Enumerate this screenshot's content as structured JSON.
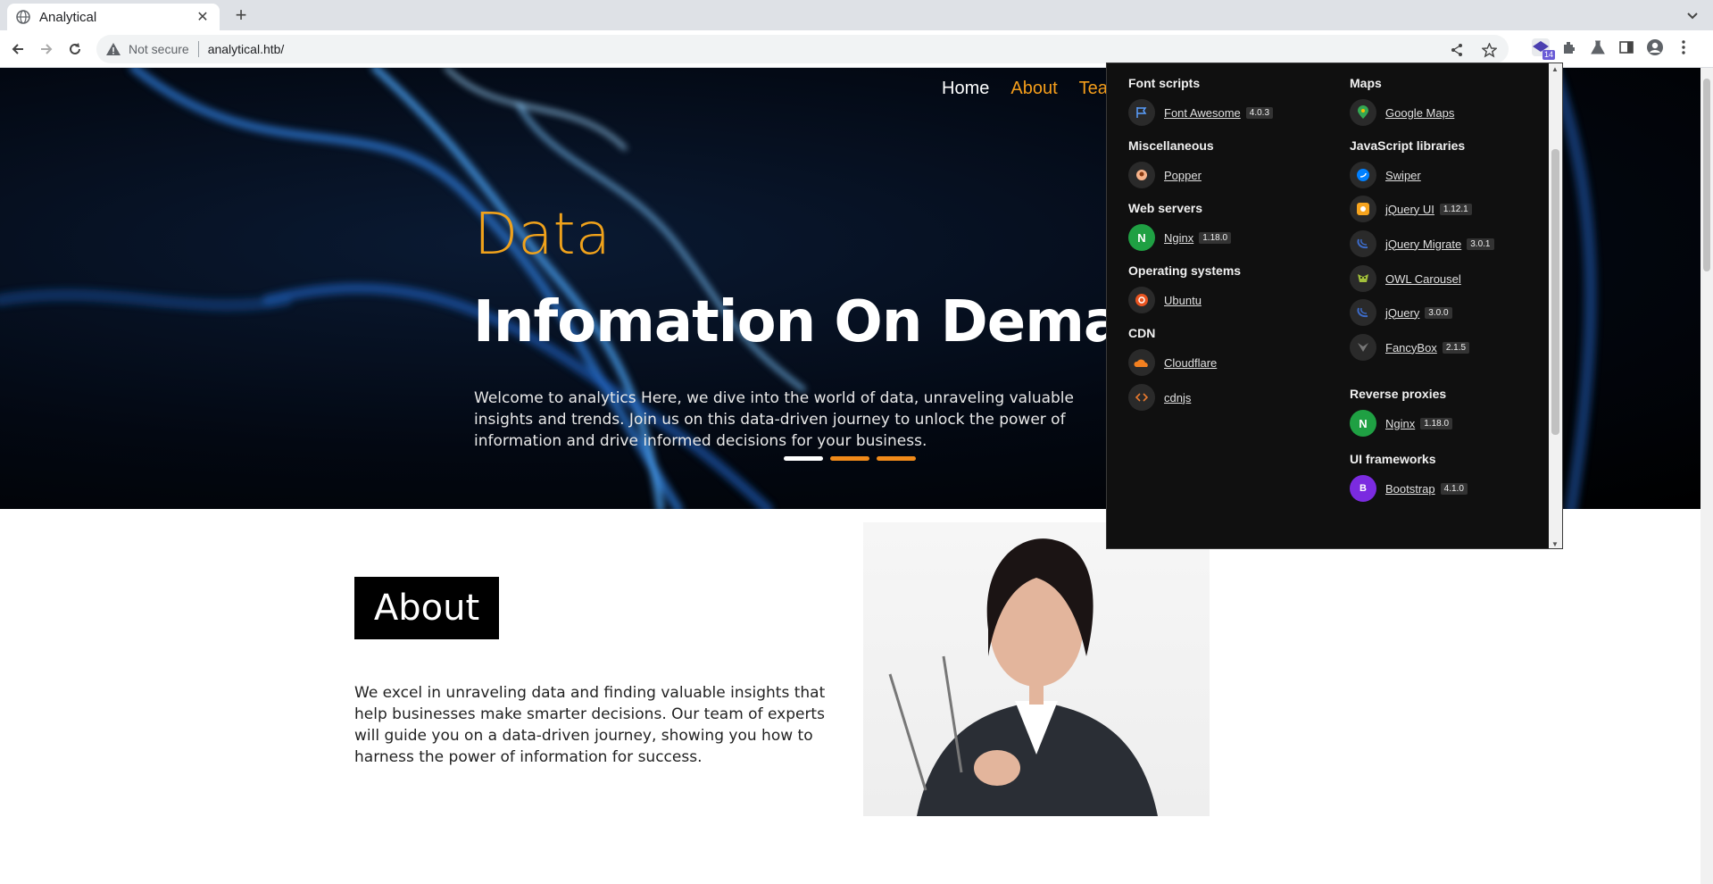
{
  "browser": {
    "tab_title": "Analytical",
    "tab_close": "✕",
    "new_tab": "+",
    "security_label": "Not secure",
    "url": "analytical.htb/",
    "extension_badge": "14"
  },
  "hero": {
    "nav": {
      "home": "Home",
      "about": "About",
      "team": "Team"
    },
    "kicker": "Data",
    "headline": "Infomation On Demand",
    "intro": "Welcome to analytics Here, we dive into the world of data, unraveling valuable insights and trends. Join us on this data-driven journey to unlock the power of information and drive informed decisions for your business."
  },
  "about": {
    "heading": "About",
    "text": "We excel in unraveling data and finding valuable insights that help businesses make smarter decisions. Our team of experts will guide you on a data-driven journey, showing you how to harness the power of information for success."
  },
  "popup": {
    "left": {
      "font_scripts": {
        "title": "Font scripts",
        "items": [
          {
            "name": "Font Awesome",
            "version": "4.0.3",
            "icon": "flag-icon"
          }
        ]
      },
      "misc": {
        "title": "Miscellaneous",
        "items": [
          {
            "name": "Popper",
            "icon": "popper-icon"
          }
        ]
      },
      "web_servers": {
        "title": "Web servers",
        "items": [
          {
            "name": "Nginx",
            "version": "1.18.0",
            "icon": "nginx-icon"
          }
        ]
      },
      "os": {
        "title": "Operating systems",
        "items": [
          {
            "name": "Ubuntu",
            "icon": "ubuntu-icon"
          }
        ]
      },
      "cdn": {
        "title": "CDN",
        "items": [
          {
            "name": "Cloudflare",
            "icon": "cloud-icon"
          },
          {
            "name": "cdnjs",
            "icon": "code-icon"
          }
        ]
      }
    },
    "right": {
      "maps": {
        "title": "Maps",
        "items": [
          {
            "name": "Google Maps",
            "icon": "map-pin-icon"
          }
        ]
      },
      "js": {
        "title": "JavaScript libraries",
        "items": [
          {
            "name": "Swiper",
            "icon": "swiper-icon"
          },
          {
            "name": "jQuery UI",
            "version": "1.12.1",
            "icon": "jquery-ui-icon"
          },
          {
            "name": "jQuery Migrate",
            "version": "3.0.1",
            "icon": "jquery-icon"
          },
          {
            "name": "OWL Carousel",
            "icon": "owl-icon"
          },
          {
            "name": "jQuery",
            "version": "3.0.0",
            "icon": "jquery-icon"
          },
          {
            "name": "FancyBox",
            "version": "2.1.5",
            "icon": "fancybox-icon"
          }
        ]
      },
      "proxies": {
        "title": "Reverse proxies",
        "items": [
          {
            "name": "Nginx",
            "version": "1.18.0",
            "icon": "nginx-icon"
          }
        ]
      },
      "ui": {
        "title": "UI frameworks",
        "items": [
          {
            "name": "Bootstrap",
            "version": "4.1.0",
            "icon": "bootstrap-icon"
          }
        ]
      }
    },
    "icon_letters": {
      "nginx": "N",
      "bootstrap": "B"
    }
  },
  "colors": {
    "accent_orange": "#f59e1b",
    "popup_bg": "#101010",
    "nginx_green": "#1fa043",
    "bootstrap_purple": "#7b2be0"
  }
}
